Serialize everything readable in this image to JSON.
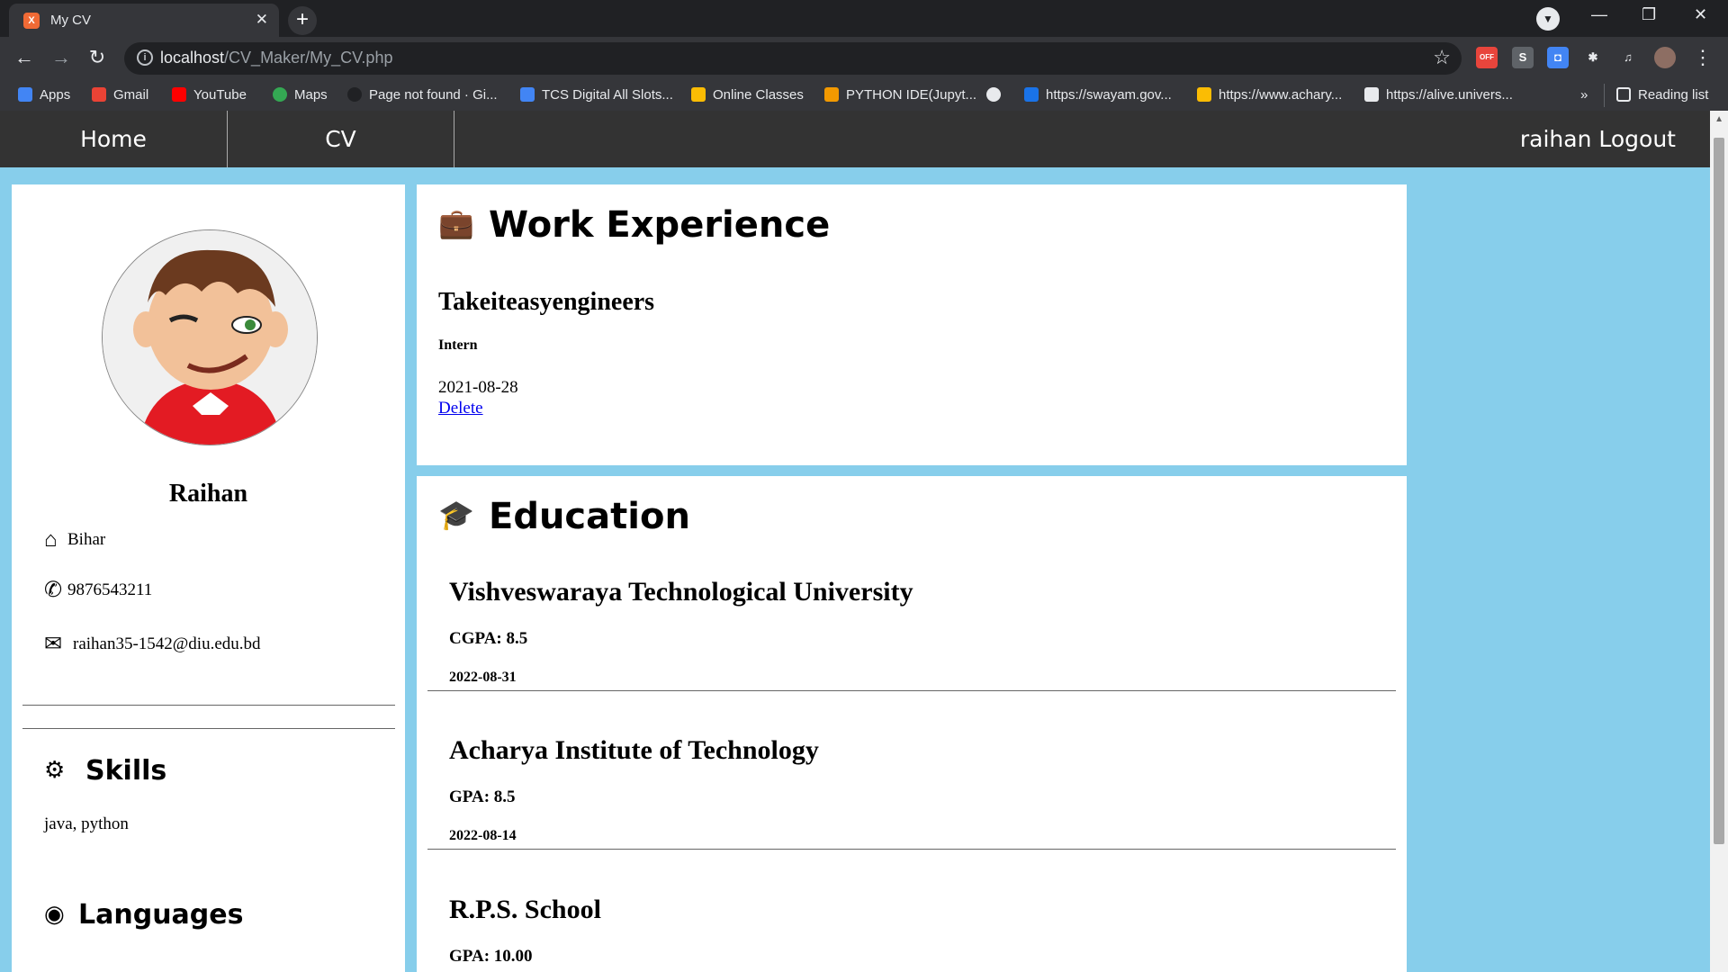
{
  "browser": {
    "tab_title": "My CV",
    "tab_favicon": "xampp-icon",
    "url_host": "localhost",
    "url_path": "/CV_Maker/My_CV.php",
    "extensions": [
      {
        "name": "off-extension",
        "label": "OFF",
        "color": "#e8453c"
      },
      {
        "name": "s-extension",
        "label": "S",
        "color": "#5f6368"
      },
      {
        "name": "camera-extension",
        "label": "◘",
        "color": "#4285f4"
      },
      {
        "name": "puzzle-extension",
        "label": "✱",
        "color": "#35363a"
      },
      {
        "name": "media-extension",
        "label": "♫",
        "color": "#35363a"
      }
    ],
    "bookmarks": [
      {
        "label": "Apps",
        "icon": "apps-grid-icon",
        "color": "#4285f4"
      },
      {
        "label": "Gmail",
        "icon": "gmail-icon",
        "color": "#ea4335"
      },
      {
        "label": "YouTube",
        "icon": "youtube-icon",
        "color": "#ff0000"
      },
      {
        "label": "Maps",
        "icon": "maps-pin-icon",
        "color": "#34a853"
      },
      {
        "label": "Page not found · Gi...",
        "icon": "github-icon",
        "color": "#202124"
      },
      {
        "label": "TCS Digital All Slots...",
        "icon": "docs-icon",
        "color": "#4285f4"
      },
      {
        "label": "Online Classes",
        "icon": "classroom-icon",
        "color": "#fbbc04"
      },
      {
        "label": "PYTHON IDE(Jupyt...",
        "icon": "book-icon",
        "color": "#f29900"
      },
      {
        "label": "",
        "icon": "globe-icon",
        "color": "#e8eaed"
      },
      {
        "label": "https://swayam.gov...",
        "icon": "swayam-icon",
        "color": "#1a73e8"
      },
      {
        "label": "https://www.achary...",
        "icon": "acharya-icon",
        "color": "#fbbc04"
      },
      {
        "label": "https://alive.univers...",
        "icon": "alive-icon",
        "color": "#e8eaed"
      }
    ],
    "bookmarks_more": "»",
    "reading_list": "Reading list"
  },
  "nav": {
    "home": "Home",
    "cv": "CV",
    "user": "raihan Logout"
  },
  "profile": {
    "avatar_caption": "Clip Art",
    "name": "Raihan",
    "address": "Bihar",
    "phone": "9876543211",
    "email": "raihan35-1542@diu.edu.bd"
  },
  "skills": {
    "heading": "Skills",
    "text": "java, python"
  },
  "languages": {
    "heading": "Languages"
  },
  "work": {
    "heading": "Work Experience",
    "company": "Takeiteasyengineers",
    "role": "Intern",
    "date": "2021-08-28",
    "delete": "Delete"
  },
  "education": {
    "heading": "Education",
    "items": [
      {
        "school": "Vishveswaraya Technological University",
        "grade": "CGPA: 8.5",
        "date": "2022-08-31"
      },
      {
        "school": "Acharya Institute of Technology",
        "grade": "GPA: 8.5",
        "date": "2022-08-14"
      },
      {
        "school": "R.P.S. School",
        "grade": "GPA: 10.00",
        "date": ""
      }
    ]
  },
  "colors": {
    "page_background": "#87ceeb",
    "navbar": "#333333",
    "link": "#0000ee"
  }
}
